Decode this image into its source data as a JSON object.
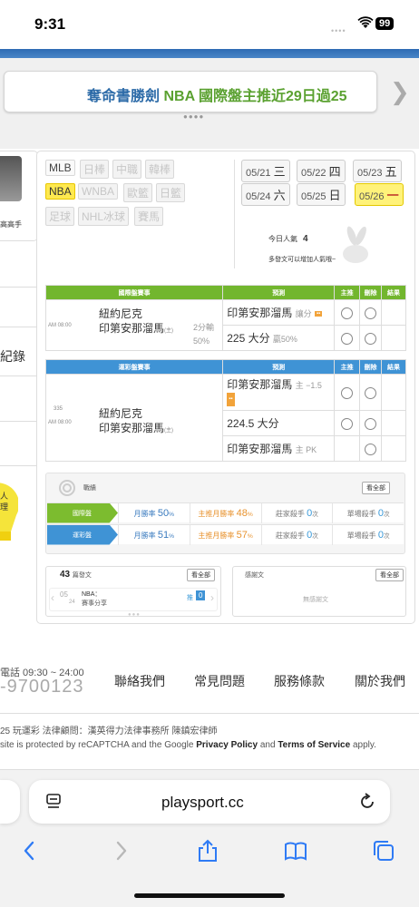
{
  "status_bar": {
    "time": "9:31",
    "battery": "99"
  },
  "banner": {
    "text_blue": "奪命書勝劍 ",
    "text_green": "NBA 國際盤主推近29日過25"
  },
  "left": {
    "label": "高高手",
    "record": "紀錄",
    "bulb_1": "人",
    "bulb_2": "理"
  },
  "sports_tags": [
    {
      "label": "MLB",
      "state": "active"
    },
    {
      "label": "日棒",
      "state": "disabled"
    },
    {
      "label": "中職",
      "state": "disabled"
    },
    {
      "label": "韓棒",
      "state": "disabled"
    },
    {
      "label": "NBA",
      "state": "selected"
    },
    {
      "label": "WNBA",
      "state": "disabled"
    },
    {
      "label": "歐籃",
      "state": "disabled"
    },
    {
      "label": "日籃",
      "state": "disabled"
    },
    {
      "label": "足球",
      "state": "disabled"
    },
    {
      "label": "NHL冰球",
      "state": "disabled"
    },
    {
      "label": "賽馬",
      "state": "disabled"
    }
  ],
  "dates": [
    {
      "date": "05/21",
      "day": "三",
      "selected": false
    },
    {
      "date": "05/22",
      "day": "四",
      "selected": false
    },
    {
      "date": "05/23",
      "day": "五",
      "selected": false
    },
    {
      "date": "05/24",
      "day": "六",
      "selected": false
    },
    {
      "date": "05/25",
      "day": "日",
      "selected": false
    },
    {
      "date": "05/26",
      "day": "一",
      "selected": true
    }
  ],
  "popularity": {
    "label": "今日人氣",
    "value": "4",
    "hint": "多發文可以增加人氣哦~"
  },
  "intl_table": {
    "headers": [
      "國際盤賽事",
      "預測",
      "主推",
      "刪除",
      "結果"
    ],
    "time": "AM 08:00",
    "team_away": "紐約尼克",
    "team_home": "印第安那溜馬",
    "home_tag": "(主)",
    "line_1": "2分輸",
    "line_2": "50%",
    "pred_1": "印第安那溜馬",
    "pred_1_note": "讓分",
    "pred_2": "225 大分",
    "pred_2_note": "贏50%"
  },
  "lottery_table": {
    "headers": [
      "運彩盤賽事",
      "預測",
      "主推",
      "刪除",
      "結果"
    ],
    "game_no": "335",
    "time": "AM 08:00",
    "team_away": "紐約尼克",
    "team_home": "印第安那溜馬",
    "home_tag": "(主)",
    "pred_1": "印第安那溜馬",
    "pred_1_note": "主 −1.5",
    "pred_2": "224.5 大分",
    "pred_3": "印第安那溜馬",
    "pred_3_note": "主 PK"
  },
  "stats": {
    "title": "戰績",
    "view_all": "看全部",
    "rows": [
      {
        "label": "國際盤",
        "color": "#7cbc2f",
        "month_win_label": "月勝率",
        "month_win": "50",
        "main_win_label": "主推月勝率",
        "main_win": "48",
        "zhuang_label": "莊家殺手",
        "zhuang": "0",
        "single_label": "單場殺手",
        "single": "0"
      },
      {
        "label": "運彩盤",
        "color": "#3f93d5",
        "month_win_label": "月勝率",
        "month_win": "51",
        "main_win_label": "主推月勝率",
        "main_win": "57",
        "zhuang_label": "莊家殺手",
        "zhuang": "0",
        "single_label": "單場殺手",
        "single": "0"
      }
    ],
    "pct": "%",
    "times": "次"
  },
  "posts": {
    "count": "43",
    "label": "篇發文",
    "view_all": "看全部",
    "item_date_1": "05",
    "item_date_2": "24",
    "item_title": "NBA：",
    "item_sub": "賽事分享",
    "push_label": "推",
    "push_count": "0"
  },
  "thanks": {
    "title": "感謝文",
    "view_all": "看全部",
    "empty": "無感謝文"
  },
  "footer": {
    "phone_label": "電話 09:30 ~ 24:00",
    "phone": "-9700123",
    "links": [
      "聯絡我們",
      "常見問題",
      "服務條款",
      "關於我們"
    ],
    "copyright": "25 玩運彩 法律顧問：漢英得力法律事務所 陳鎮宏律師",
    "recaptcha_pre": "site is protected by reCAPTCHA and the Google ",
    "privacy": "Privacy Policy",
    "and": " and ",
    "terms": "Terms of Service",
    "apply": " apply."
  },
  "browser": {
    "url": "playsport.cc"
  }
}
